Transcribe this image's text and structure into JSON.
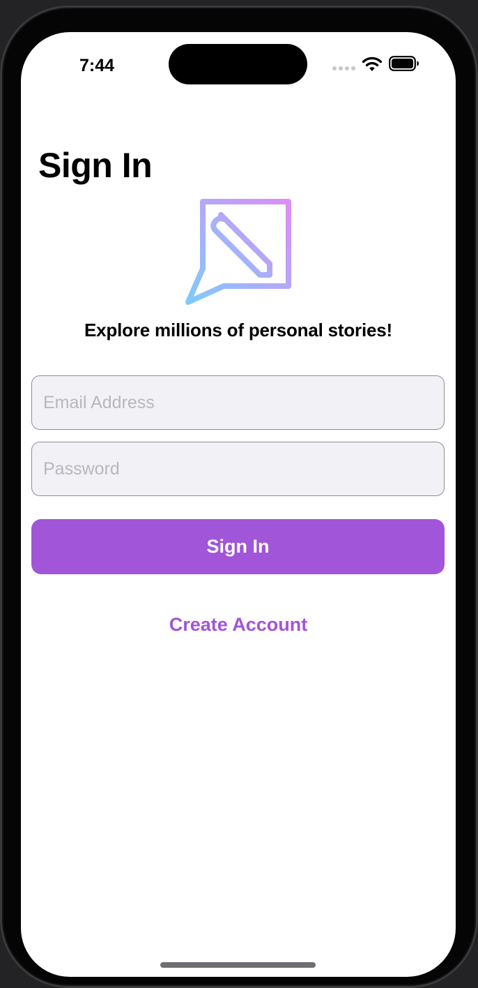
{
  "status_bar": {
    "time": "7:44",
    "icons": [
      "cellular-signal-icon",
      "wifi-icon",
      "battery-icon"
    ]
  },
  "page": {
    "title": "Sign In",
    "logo_icon": "chat-bubble-pencil-icon",
    "tagline": "Explore millions of personal stories!"
  },
  "form": {
    "email": {
      "value": "",
      "placeholder": "Email Address"
    },
    "password": {
      "value": "",
      "placeholder": "Password"
    },
    "sign_in_label": "Sign In",
    "create_account_label": "Create Account"
  },
  "colors": {
    "accent": "#a155d8",
    "logo_gradient_start": "#7fcbfb",
    "logo_gradient_end": "#dd8df4",
    "field_background": "#f2f2f6",
    "field_border": "#8e8e93",
    "placeholder": "#b7b7bd"
  }
}
